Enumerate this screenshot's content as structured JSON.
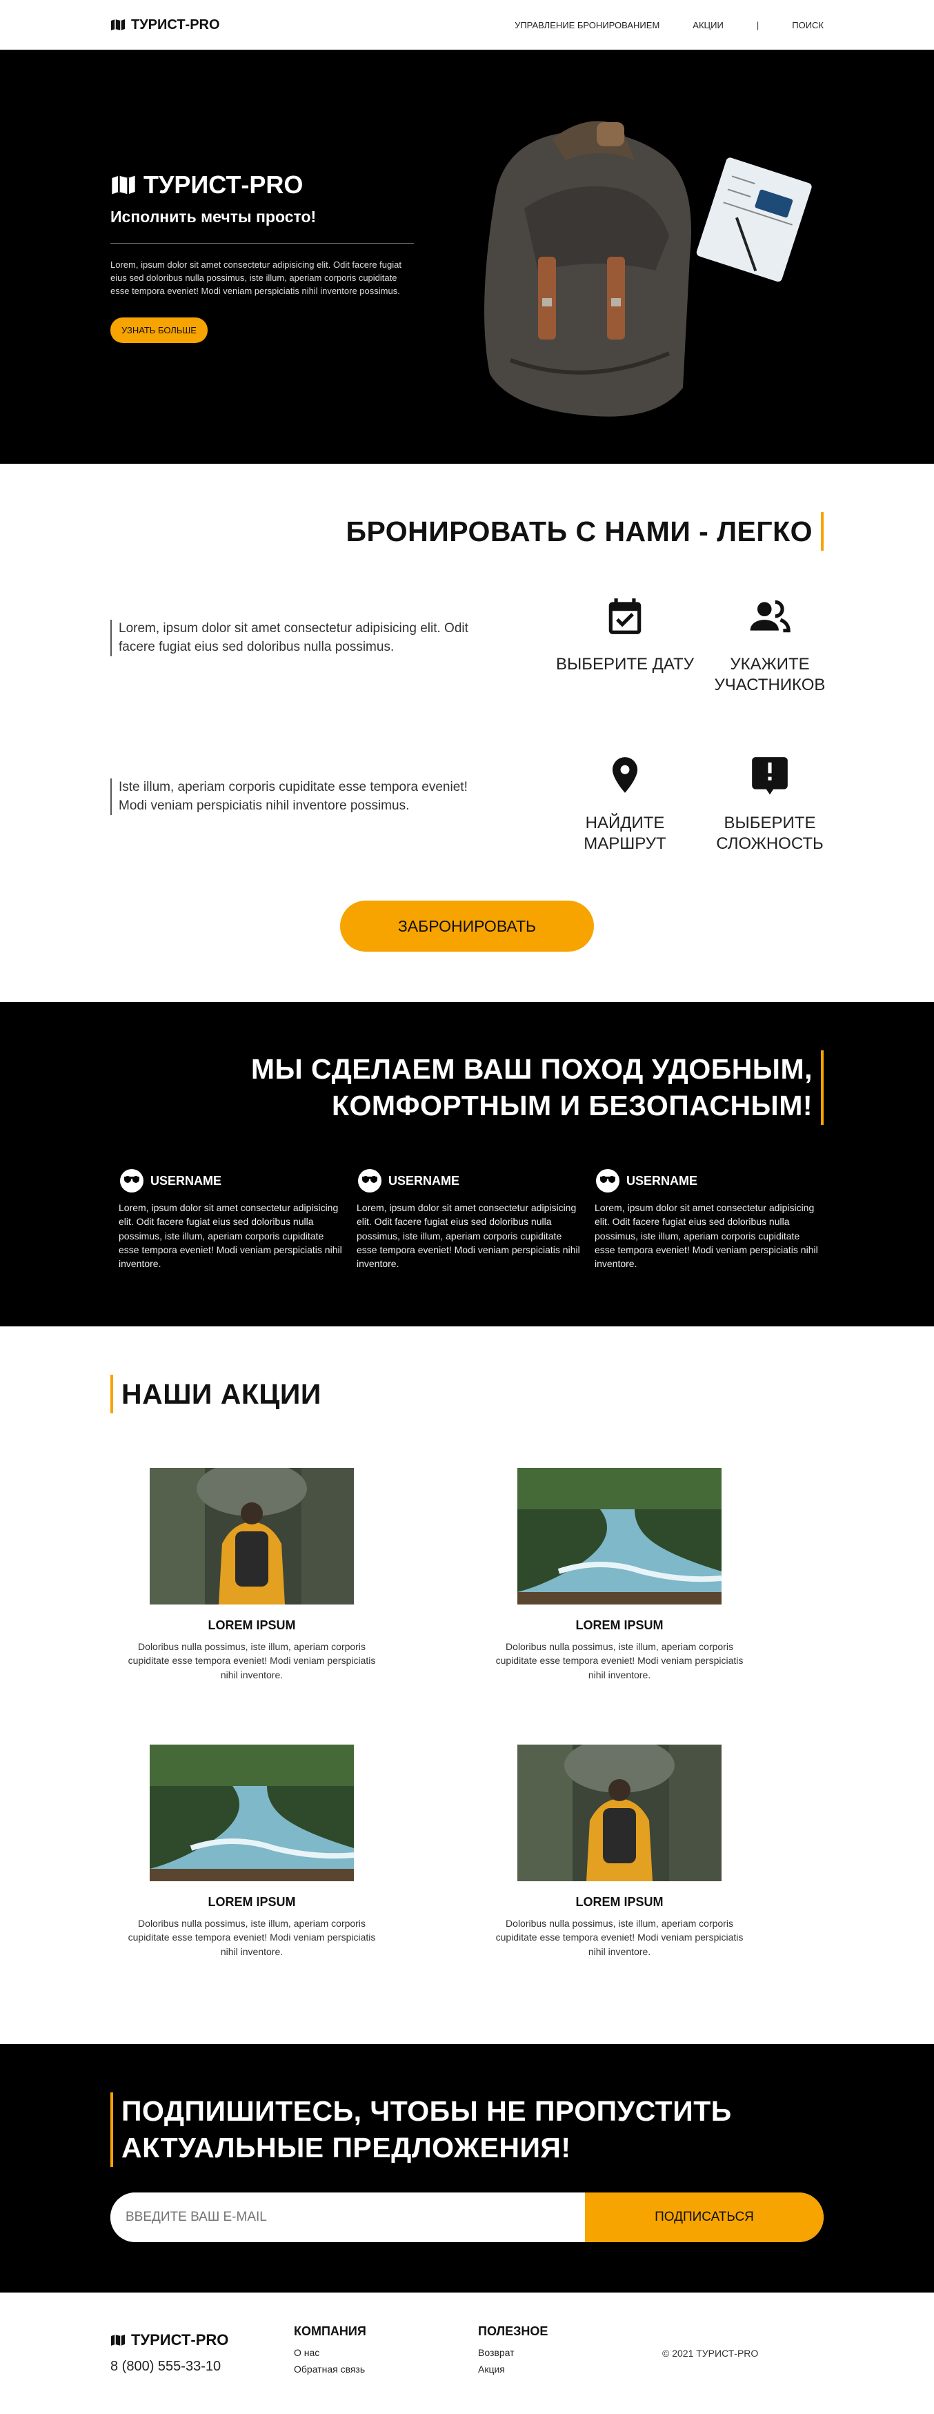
{
  "header": {
    "brand": "ТУРИСТ-PRO",
    "nav": [
      "УПРАВЛЕНИЕ БРОНИРОВАНИЕМ",
      "АКЦИИ",
      "|",
      "ПОИСК"
    ]
  },
  "hero": {
    "title": "ТУРИСТ-PRO",
    "subtitle": "Исполнить мечты просто!",
    "text": "Lorem, ipsum dolor sit amet consectetur adipisicing elit. Odit facere fugiat eius sed doloribus nulla possimus, iste illum, aperiam corporis cupiditate esse tempora eveniet! Modi veniam perspiciatis nihil inventore possimus.",
    "button": "УЗНАТЬ БОЛЬШЕ"
  },
  "booking": {
    "heading": "БРОНИРОВАТЬ С НАМИ - ЛЕГКО",
    "text1": "Lorem, ipsum dolor sit amet consectetur adipisicing elit. Odit facere fugiat eius sed doloribus nulla possimus.",
    "text2": "Iste illum, aperiam corporis cupiditate esse tempora eveniet! Modi veniam perspiciatis nihil inventore possimus.",
    "features": [
      {
        "label": "ВЫБЕРИТЕ ДАТУ",
        "icon": "calendar-check-icon"
      },
      {
        "label": "УКАЖИТЕ УЧАСТНИКОВ",
        "icon": "users-icon"
      },
      {
        "label": "НАЙДИТЕ МАРШРУТ",
        "icon": "map-pin-icon"
      },
      {
        "label": "ВЫБЕРИТЕ СЛОЖНОСТЬ",
        "icon": "alert-message-icon"
      }
    ],
    "button": "ЗАБРОНИРОВАТЬ"
  },
  "comfort": {
    "heading_line1": "МЫ СДЕЛАЕМ ВАШ ПОХОД УДОБНЫМ,",
    "heading_line2": "КОМФОРТНЫМ И БЕЗОПАСНЫМ!",
    "reviews": [
      {
        "user": "USERNAME",
        "text": "Lorem, ipsum dolor sit amet consectetur adipisicing elit. Odit facere fugiat eius sed doloribus nulla possimus, iste illum, aperiam corporis cupiditate esse tempora eveniet! Modi veniam perspiciatis nihil inventore."
      },
      {
        "user": "USERNAME",
        "text": "Lorem, ipsum dolor sit amet consectetur adipisicing elit. Odit facere fugiat eius sed doloribus nulla possimus, iste illum, aperiam corporis cupiditate esse tempora eveniet! Modi veniam perspiciatis nihil inventore."
      },
      {
        "user": "USERNAME",
        "text": "Lorem, ipsum dolor sit amet consectetur adipisicing elit. Odit facere fugiat eius sed doloribus nulla possimus, iste illum, aperiam corporis cupiditate esse tempora eveniet! Modi veniam perspiciatis nihil inventore."
      }
    ]
  },
  "promos": {
    "heading": "НАШИ АКЦИИ",
    "cards": [
      {
        "title": "LOREM IPSUM",
        "text": "Doloribus nulla possimus, iste illum, aperiam corporis cupiditate esse tempora eveniet! Modi veniam perspiciatis nihil inventore.",
        "image": "hiker-image"
      },
      {
        "title": "LOREM IPSUM",
        "text": "Doloribus nulla possimus, iste illum, aperiam corporis cupiditate esse tempora eveniet! Modi veniam perspiciatis nihil inventore.",
        "image": "river-image"
      },
      {
        "title": "LOREM IPSUM",
        "text": "Doloribus nulla possimus, iste illum, aperiam corporis cupiditate esse tempora eveniet! Modi veniam perspiciatis nihil inventore.",
        "image": "river-image"
      },
      {
        "title": "LOREM IPSUM",
        "text": "Doloribus nulla possimus, iste illum, aperiam corporis cupiditate esse tempora eveniet! Modi veniam perspiciatis nihil inventore.",
        "image": "hiker-image"
      }
    ]
  },
  "subscribe": {
    "heading_line1": "ПОДПИШИТЕСЬ, ЧТОБЫ НЕ ПРОПУСТИТЬ",
    "heading_line2": "АКТУАЛЬНЫЕ ПРЕДЛОЖЕНИЯ!",
    "placeholder": "ВВЕДИТЕ ВАШ E-MAIL",
    "button": "ПОДПИСАТЬСЯ"
  },
  "footer": {
    "brand": "ТУРИСТ-PRO",
    "phone": "8 (800) 555-33-10",
    "col1_title": "КОМПАНИЯ",
    "col1_links": [
      "О нас",
      "Обратная связь"
    ],
    "col2_title": "ПОЛЕЗНОЕ",
    "col2_links": [
      "Возврат",
      "Акция"
    ],
    "copyright": "© 2021 ТУРИСТ-PRO"
  },
  "colors": {
    "accent": "#f7a400",
    "dark": "#000000"
  }
}
